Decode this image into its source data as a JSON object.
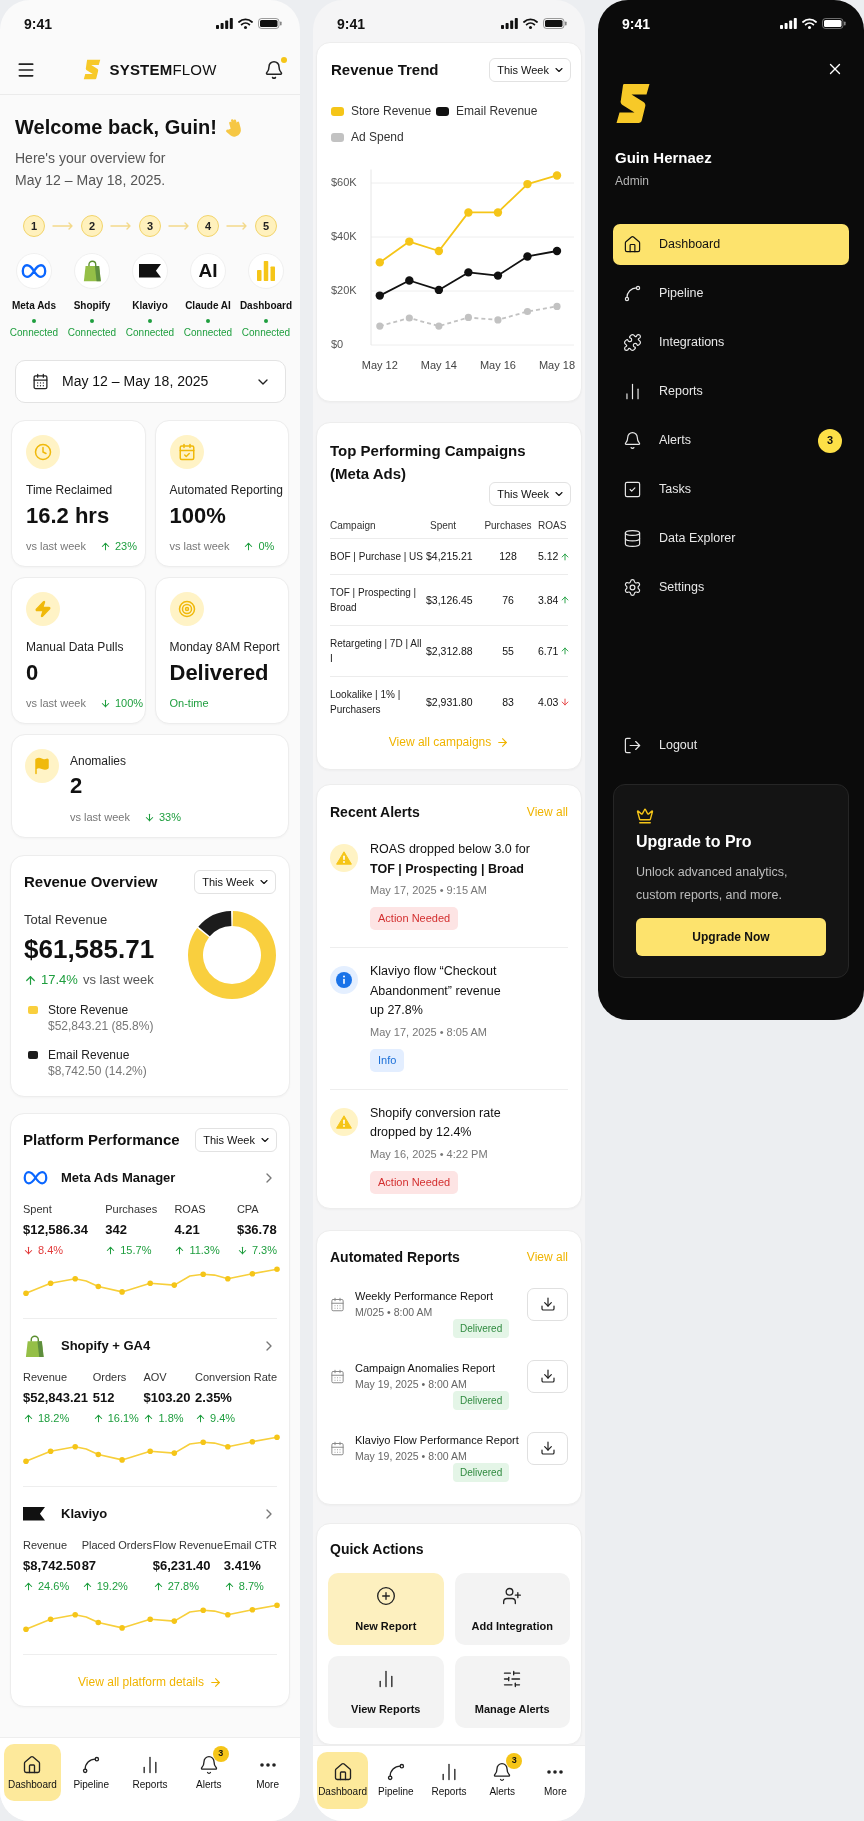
{
  "dashboard_screen": {
    "time": "9:41",
    "header": {
      "brand": "**SYSTEM**FLOW",
      "has_notification": true
    },
    "welcome": {
      "title": "Welcome back, Guin!",
      "subtitle_lines": [
        "Here's your overview for",
        "May 12 – May 18, 2025."
      ]
    },
    "integrations": [
      {
        "step": "1",
        "kind": "infinity",
        "name": "Meta Ads",
        "status": "Connected",
        "connected": true
      },
      {
        "step": "2",
        "kind": "bag",
        "name": "Shopify",
        "status": "Connected",
        "connected": true
      },
      {
        "step": "3",
        "kind": "flag",
        "name": "Klaviyo",
        "status": "Connected",
        "connected": true
      },
      {
        "step": "4",
        "kind": "text",
        "logo_text": "AI",
        "name": "Claude AI",
        "status": "Connected",
        "connected": true
      },
      {
        "step": "5",
        "kind": "bars",
        "name": "Dashboard",
        "status": "Connected",
        "connected": true
      }
    ],
    "date_range": "May 12 – May 18, 2025",
    "stats": [
      {
        "kind": "clock",
        "label": "Time Reclaimed",
        "value": "16.2 hrs",
        "compare": "vs last week",
        "change": "23%",
        "rising": true,
        "positive": true
      },
      {
        "kind": "calendar",
        "label": "Automated Reporting",
        "value": "100%",
        "compare": "vs last week",
        "change": "0%",
        "rising": true,
        "positive": true
      },
      {
        "kind": "bolt",
        "label": "Manual Data Pulls",
        "value": "0",
        "compare": "vs last week",
        "change": "100%",
        "rising": false,
        "positive": true
      },
      {
        "kind": "target",
        "label": "Monday 8AM Report",
        "value": "Delivered",
        "note": "On-time"
      }
    ],
    "anomalies": {
      "kind": "flag",
      "label": "Anomalies",
      "value": "2",
      "compare": "vs last week",
      "change": "33%",
      "rising": false,
      "positive": true
    },
    "revenue_overview": {
      "title": "Revenue Overview",
      "period": "This Week",
      "total_label": "Total Revenue",
      "total": "$61,585.71",
      "change": "17.4%",
      "rising": true,
      "positive": true,
      "compare": "vs last week",
      "chart_data": {
        "type": "donut",
        "categories": [
          "Store Revenue",
          "Email Revenue"
        ],
        "values": [
          85.8,
          14.2
        ]
      },
      "legend": [
        {
          "detail": "$52,843.21 (85.8%)",
          "color": "#f9cf3e"
        },
        {
          "detail": "$8,742.50 (14.2%)",
          "color": "#1c1c1c"
        }
      ]
    },
    "platform_performance": {
      "title": "Platform Performance",
      "period": "This Week",
      "platforms": [
        {
          "kind": "infinity",
          "name": "Meta Ads Manager",
          "metrics": [
            {
              "label": "Spent",
              "value": "$12,586.34",
              "change": "8.4%",
              "rising": false,
              "positive": false
            },
            {
              "label": "Purchases",
              "value": "342",
              "change": "15.7%",
              "rising": true,
              "positive": true
            },
            {
              "label": "ROAS",
              "value": "4.21",
              "change": "11.3%",
              "rising": true,
              "positive": true
            },
            {
              "label": "CPA",
              "value": "$36.78",
              "change": "7.3%",
              "rising": false,
              "positive": true
            }
          ]
        },
        {
          "kind": "bag",
          "name": "Shopify + GA4",
          "metrics": [
            {
              "label": "Revenue",
              "value": "$52,843.21",
              "change": "18.2%",
              "rising": true,
              "positive": true
            },
            {
              "label": "Orders",
              "value": "512",
              "change": "16.1%",
              "rising": true,
              "positive": true
            },
            {
              "label": "AOV",
              "value": "$103.20",
              "change": "1.8%",
              "rising": true,
              "positive": true
            },
            {
              "label": "Conversion Rate",
              "value": "2.35%",
              "change": "9.4%",
              "rising": true,
              "positive": true
            }
          ]
        },
        {
          "kind": "flag",
          "name": "Klaviyo",
          "metrics": [
            {
              "label": "Revenue",
              "value": "$8,742.50",
              "change": "24.6%",
              "rising": true,
              "positive": true
            },
            {
              "label": "Placed Orders",
              "value": "87",
              "change": "19.2%",
              "rising": true,
              "positive": true
            },
            {
              "label": "Flow Revenue",
              "value": "$6,231.40",
              "change": "27.8%",
              "rising": true,
              "positive": true
            },
            {
              "label": "Email CTR",
              "value": "3.41%",
              "change": "8.7%",
              "rising": true,
              "positive": true
            }
          ]
        }
      ],
      "link": "View all platform details"
    },
    "nav": [
      {
        "label": "Dashboard",
        "kind": "home",
        "selected": true
      },
      {
        "label": "Pipeline",
        "kind": "pipeline",
        "selected": false
      },
      {
        "label": "Reports",
        "kind": "reports",
        "selected": false
      },
      {
        "label": "Alerts",
        "kind": "bell",
        "selected": false,
        "badge": "3"
      },
      {
        "label": "More",
        "kind": "more",
        "selected": false
      }
    ]
  },
  "analytics_screen": {
    "time": "9:41",
    "revenue_trend": {
      "title": "Revenue Trend",
      "period": "This Week",
      "chart_data": {
        "type": "line",
        "grid": true,
        "categories": [
          "May 12",
          null,
          "May 14",
          null,
          "May 16",
          null,
          "May 18"
        ],
        "series": [
          {
            "name": "Store Revenue",
            "color": "#f5c518",
            "line_style": "solid",
            "marker": "circle",
            "values": [
              30600,
              38300,
              34800,
              49100,
              49100,
              59600,
              62800
            ]
          },
          {
            "name": "Email Revenue",
            "color": "#111111",
            "line_style": "solid",
            "marker": "circle",
            "values": [
              18300,
              23900,
              20400,
              26900,
              25700,
              32800,
              34800
            ]
          },
          {
            "name": "Ad Spend",
            "color": "#c2c2c2",
            "line_style": "dashed",
            "marker": "circle",
            "values": [
              7000,
              10000,
              7000,
              10200,
              9300,
              12400,
              14300
            ]
          }
        ],
        "ylim": [
          0,
          65000
        ],
        "yticks": [
          {
            "value": 0,
            "label": "$0"
          },
          {
            "value": 20000,
            "label": "$20K"
          },
          {
            "value": 40000,
            "label": "$40K"
          },
          {
            "value": 60000,
            "label": "$60K"
          }
        ]
      }
    },
    "top_campaigns": {
      "title": "Top Performing Campaigns (Meta Ads)",
      "period": "This Week",
      "columns": [
        "Campaign",
        "Spent",
        "Purchases",
        "ROAS"
      ],
      "rows": [
        {
          "campaign": "BOF | Purchase | US",
          "spent": "$4,215.21",
          "purchases": "128",
          "roas": "5.12",
          "rising": true,
          "positive": true
        },
        {
          "campaign": "TOF | Prospecting | Broad",
          "spent": "$3,126.45",
          "purchases": "76",
          "roas": "3.84",
          "rising": true,
          "positive": true
        },
        {
          "campaign": "Retargeting | 7D | All I",
          "spent": "$2,312.88",
          "purchases": "55",
          "roas": "6.71",
          "rising": true,
          "positive": true
        },
        {
          "campaign": "Lookalike | 1% | Purchasers",
          "spent": "$2,931.80",
          "purchases": "83",
          "roas": "4.03",
          "rising": false,
          "positive": false
        }
      ],
      "link": "View all campaigns"
    },
    "recent_alerts": {
      "title": "Recent Alerts",
      "link": "View all",
      "items": [
        {
          "kind": "warning",
          "message_lines": [
            "ROAS dropped below 3.0 for",
            "**TOF | Prospecting | Broad**"
          ],
          "timestamp": "May 17, 2025 • 9:15 AM",
          "tag": "Action Needed"
        },
        {
          "kind": "info",
          "message_lines": [
            "Klaviyo flow “Checkout",
            "Abandonment” revenue",
            "up 27.8%"
          ],
          "timestamp": "May 17, 2025 • 8:05 AM",
          "tag": "Info"
        },
        {
          "kind": "warning",
          "message_lines": [
            "Shopify conversion rate",
            "dropped by 12.4%"
          ],
          "timestamp": "May 16, 2025 • 4:22 PM",
          "tag": "Action Needed"
        }
      ]
    },
    "automated_reports": {
      "title": "Automated Reports",
      "link": "View all",
      "items": [
        {
          "name": "Weekly Performance Report",
          "schedule": "M/025 • 8:00 AM",
          "status": "Delivered"
        },
        {
          "name": "Campaign Anomalies Report",
          "schedule": "May 19, 2025 • 8:00 AM",
          "status": "Delivered"
        },
        {
          "name": "Klaviyo Flow Performance Report",
          "schedule": "May 19, 2025 • 8:00 AM",
          "status": "Delivered"
        }
      ]
    },
    "quick_actions": {
      "title": "Quick Actions",
      "actions": [
        {
          "kind": "plus",
          "label": "New Report",
          "highlighted": true
        },
        {
          "kind": "user_plus",
          "label": "Add Integration",
          "highlighted": false
        },
        {
          "kind": "reports",
          "label": "View Reports",
          "highlighted": false
        },
        {
          "kind": "sliders",
          "label": "Manage Alerts",
          "highlighted": false
        }
      ]
    },
    "nav": [
      {
        "label": "Dashboard",
        "kind": "home",
        "selected": true
      },
      {
        "label": "Pipeline",
        "kind": "pipeline",
        "selected": false
      },
      {
        "label": "Reports",
        "kind": "reports",
        "selected": false
      },
      {
        "label": "Alerts",
        "kind": "bell",
        "selected": false,
        "badge": "3"
      },
      {
        "label": "More",
        "kind": "more",
        "selected": false
      }
    ]
  },
  "menu_screen": {
    "time": "9:41",
    "user": {
      "name": "Guin Hernaez",
      "role": "Admin"
    },
    "items": [
      {
        "kind": "home",
        "label": "Dashboard",
        "selected": true
      },
      {
        "kind": "pipeline",
        "label": "Pipeline",
        "selected": false
      },
      {
        "kind": "puzzle",
        "label": "Integrations",
        "selected": false
      },
      {
        "kind": "reports",
        "label": "Reports",
        "selected": false
      },
      {
        "kind": "bell",
        "label": "Alerts",
        "selected": false,
        "badge": "3"
      },
      {
        "kind": "tasks",
        "label": "Tasks",
        "selected": false
      },
      {
        "kind": "database",
        "label": "Data Explorer",
        "selected": false
      },
      {
        "kind": "settings",
        "label": "Settings",
        "selected": false
      }
    ],
    "logout": "Logout",
    "upgrade": {
      "title": "Upgrade to Pro",
      "text": "Unlock advanced analytics, custom reports, and more.",
      "button": "Upgrade Now"
    }
  }
}
